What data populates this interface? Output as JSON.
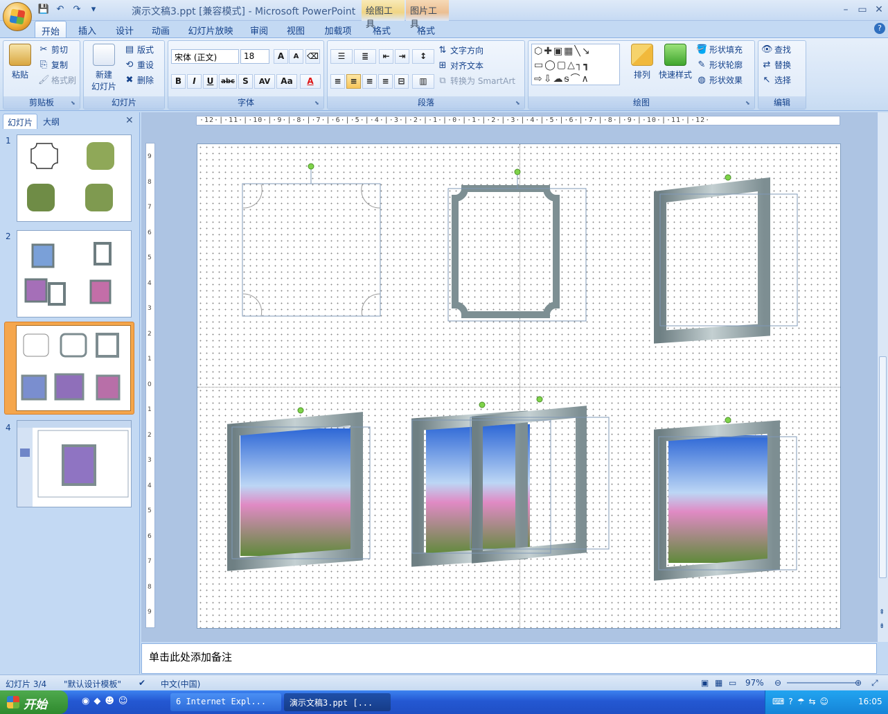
{
  "window": {
    "title": "演示文稿3.ppt [兼容模式] - Microsoft PowerPoint",
    "context_tabs": [
      "绘图工具",
      "图片工具"
    ],
    "controls": [
      "–",
      "▭",
      "✕"
    ]
  },
  "qat": [
    "💾",
    "↶",
    "↷",
    "▾"
  ],
  "tabs": [
    {
      "label": "开始",
      "active": true
    },
    {
      "label": "插入"
    },
    {
      "label": "设计"
    },
    {
      "label": "动画"
    },
    {
      "label": "幻灯片放映"
    },
    {
      "label": "审阅"
    },
    {
      "label": "视图"
    },
    {
      "label": "加载项"
    },
    {
      "label": "格式"
    },
    {
      "label": "格式"
    }
  ],
  "ribbon": {
    "clipboard": {
      "label": "剪贴板",
      "paste": "粘贴",
      "cut": "剪切",
      "copy": "复制",
      "format_painter": "格式刷"
    },
    "slides": {
      "label": "幻灯片",
      "new_slide": "新建",
      "new_slide2": "幻灯片",
      "layout": "版式",
      "reset": "重设",
      "delete": "删除"
    },
    "font": {
      "label": "字体",
      "font_name": "宋体 (正文)",
      "font_size": "18",
      "grow": "A",
      "shrink": "A",
      "bold": "B",
      "italic": "I",
      "underline": "U",
      "strike": "abc",
      "shadow": "S",
      "spacing": "AV",
      "case": "Aa",
      "color": "A"
    },
    "paragraph": {
      "label": "段落",
      "text_direction": "文字方向",
      "align_text": "对齐文本",
      "smartart": "转换为 SmartArt"
    },
    "drawing": {
      "label": "绘图",
      "arrange": "排列",
      "quick_styles": "快速样式",
      "shape_fill": "形状填充",
      "shape_outline": "形状轮廓",
      "shape_effects": "形状效果"
    },
    "editing": {
      "label": "编辑",
      "find": "查找",
      "replace": "替换",
      "select": "选择"
    }
  },
  "left_pane": {
    "tabs": [
      "幻灯片",
      "大纲"
    ],
    "close": "✕",
    "thumbnails": [
      {
        "num": "1"
      },
      {
        "num": "2"
      },
      {
        "num": "3",
        "selected": true
      },
      {
        "num": "4"
      }
    ]
  },
  "ruler": {
    "horizontal": "·12·|·11·|·10·|·9·|·8·|·7·|·6·|·5·|·4·|·3·|·2·|·1·|·0·|·1·|·2·|·3·|·4·|·5·|·6·|·7·|·8·|·9·|·10·|·11·|·12·",
    "vertical": [
      "9",
      "8",
      "7",
      "6",
      "5",
      "4",
      "3",
      "2",
      "1",
      "0",
      "1",
      "2",
      "3",
      "4",
      "5",
      "6",
      "7",
      "8",
      "9"
    ]
  },
  "notes": {
    "placeholder": "单击此处添加备注"
  },
  "status": {
    "slide": "幻灯片 3/4",
    "theme": "\"默认设计模板\"",
    "lang": "中文(中国)",
    "zoom": "97%"
  },
  "taskbar": {
    "start": "开始",
    "tasks": [
      "6 Internet Expl...",
      "演示文稿3.ppt [..."
    ],
    "clock": "16:05"
  },
  "colors": {
    "accent": "#15428b",
    "ribbon": "#d3e3f6",
    "selected_thumb": "#f5a64c",
    "frame": "#8ea0a4"
  }
}
